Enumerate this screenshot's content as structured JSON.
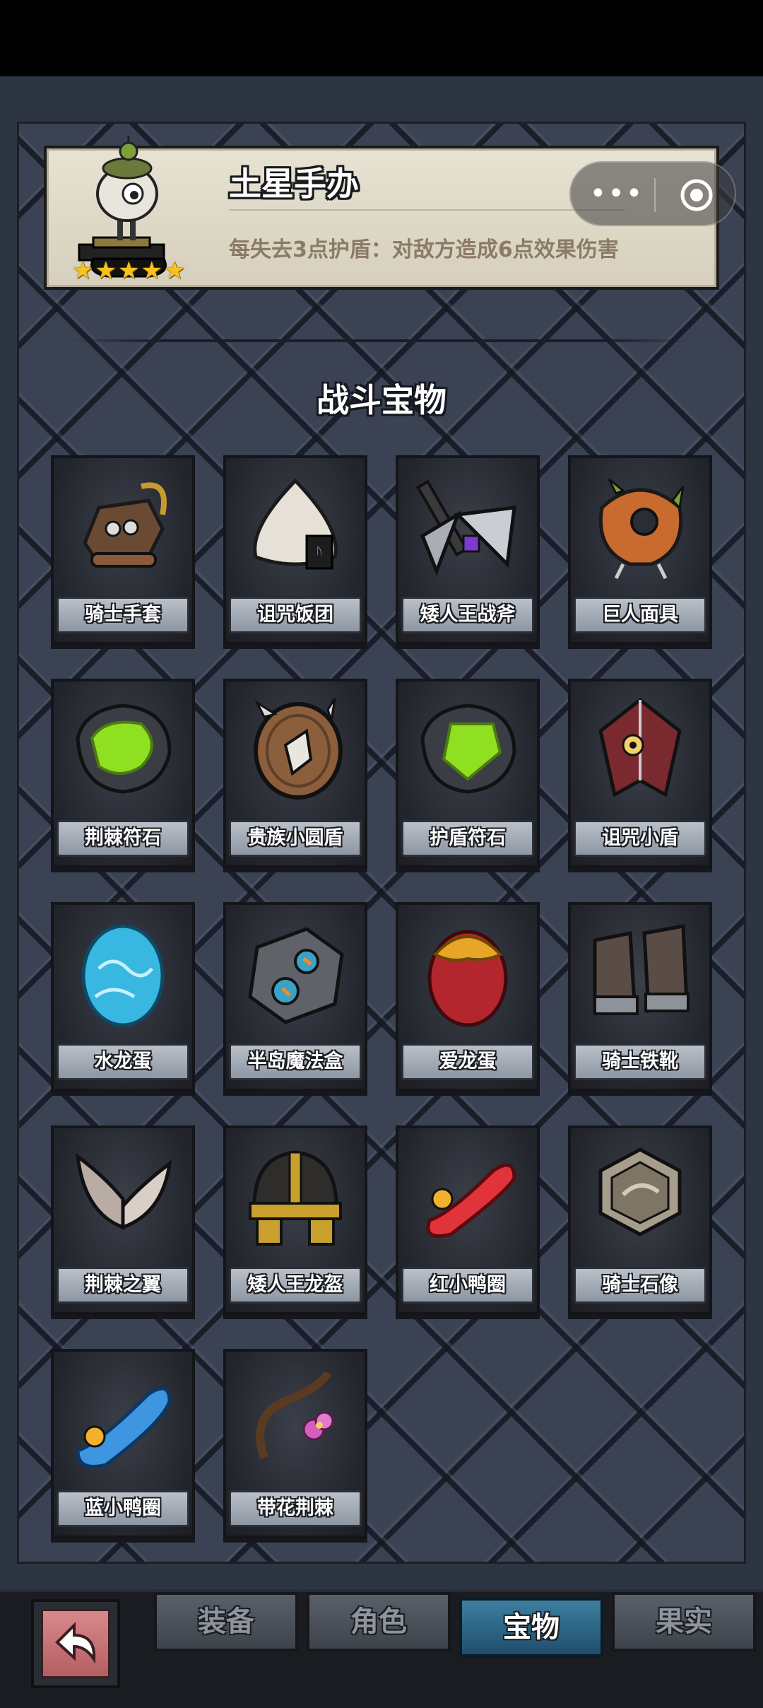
{
  "featured": {
    "name": "土星手办",
    "description": "每失去3点护盾：对敌方造成6点效果伤害",
    "stars": 5
  },
  "capsule": {
    "more_label": "•••"
  },
  "section_title": "战斗宝物",
  "items": [
    {
      "label": "骑士手套",
      "icon": "gauntlet-icon"
    },
    {
      "label": "诅咒饭团",
      "icon": "rice-ball-icon"
    },
    {
      "label": "矮人王战斧",
      "icon": "battle-axe-icon"
    },
    {
      "label": "巨人面具",
      "icon": "giant-mask-icon"
    },
    {
      "label": "荆棘符石",
      "icon": "thorn-runestone-icon"
    },
    {
      "label": "贵族小圆盾",
      "icon": "round-shield-icon"
    },
    {
      "label": "护盾符石",
      "icon": "shield-runestone-icon"
    },
    {
      "label": "诅咒小盾",
      "icon": "cursed-shield-icon"
    },
    {
      "label": "水龙蛋",
      "icon": "water-dragon-egg-icon"
    },
    {
      "label": "半岛魔法盒",
      "icon": "magic-box-icon"
    },
    {
      "label": "爱龙蛋",
      "icon": "love-dragon-egg-icon"
    },
    {
      "label": "骑士铁靴",
      "icon": "iron-boots-icon"
    },
    {
      "label": "荆棘之翼",
      "icon": "thorn-wings-icon"
    },
    {
      "label": "矮人王龙盔",
      "icon": "dragon-helmet-icon"
    },
    {
      "label": "红小鸭圈",
      "icon": "red-duck-ring-icon"
    },
    {
      "label": "骑士石像",
      "icon": "knight-statue-icon"
    },
    {
      "label": "蓝小鸭圈",
      "icon": "blue-duck-ring-icon"
    },
    {
      "label": "带花荆棘",
      "icon": "flower-thorn-icon"
    }
  ],
  "tabs": [
    {
      "label": "装备",
      "active": false
    },
    {
      "label": "角色",
      "active": false
    },
    {
      "label": "宝物",
      "active": true
    },
    {
      "label": "果实",
      "active": false
    }
  ],
  "colors": {
    "accent_tab": "#2f6a8c",
    "star": "#f7c21f",
    "back_button": "#c26d70"
  }
}
